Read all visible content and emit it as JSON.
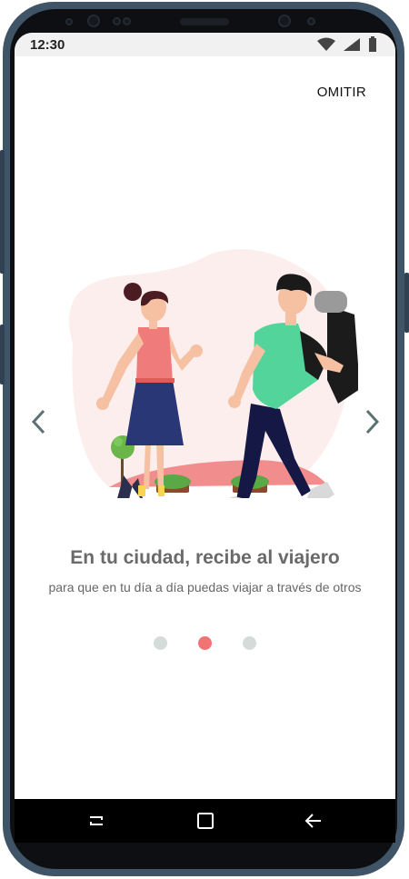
{
  "status_bar": {
    "time": "12:30",
    "icons": [
      "wifi-icon",
      "signal-icon",
      "battery-icon"
    ]
  },
  "onboarding": {
    "skip_label": "OMITIR",
    "title": "En tu ciudad, recibe al viajero",
    "subtitle": "para que en tu día a día puedas viajar a través de otros",
    "page_indicator": {
      "total": 3,
      "active_index": 1
    },
    "illustration": "couple-walking-illustration"
  },
  "colors": {
    "accent": "#f27373",
    "dot_inactive": "#d5dbdb",
    "text_title": "#6a6a6a",
    "arrow": "#5c7272"
  },
  "nav_bar": {
    "buttons": [
      "recents-icon",
      "home-icon",
      "back-icon"
    ]
  }
}
